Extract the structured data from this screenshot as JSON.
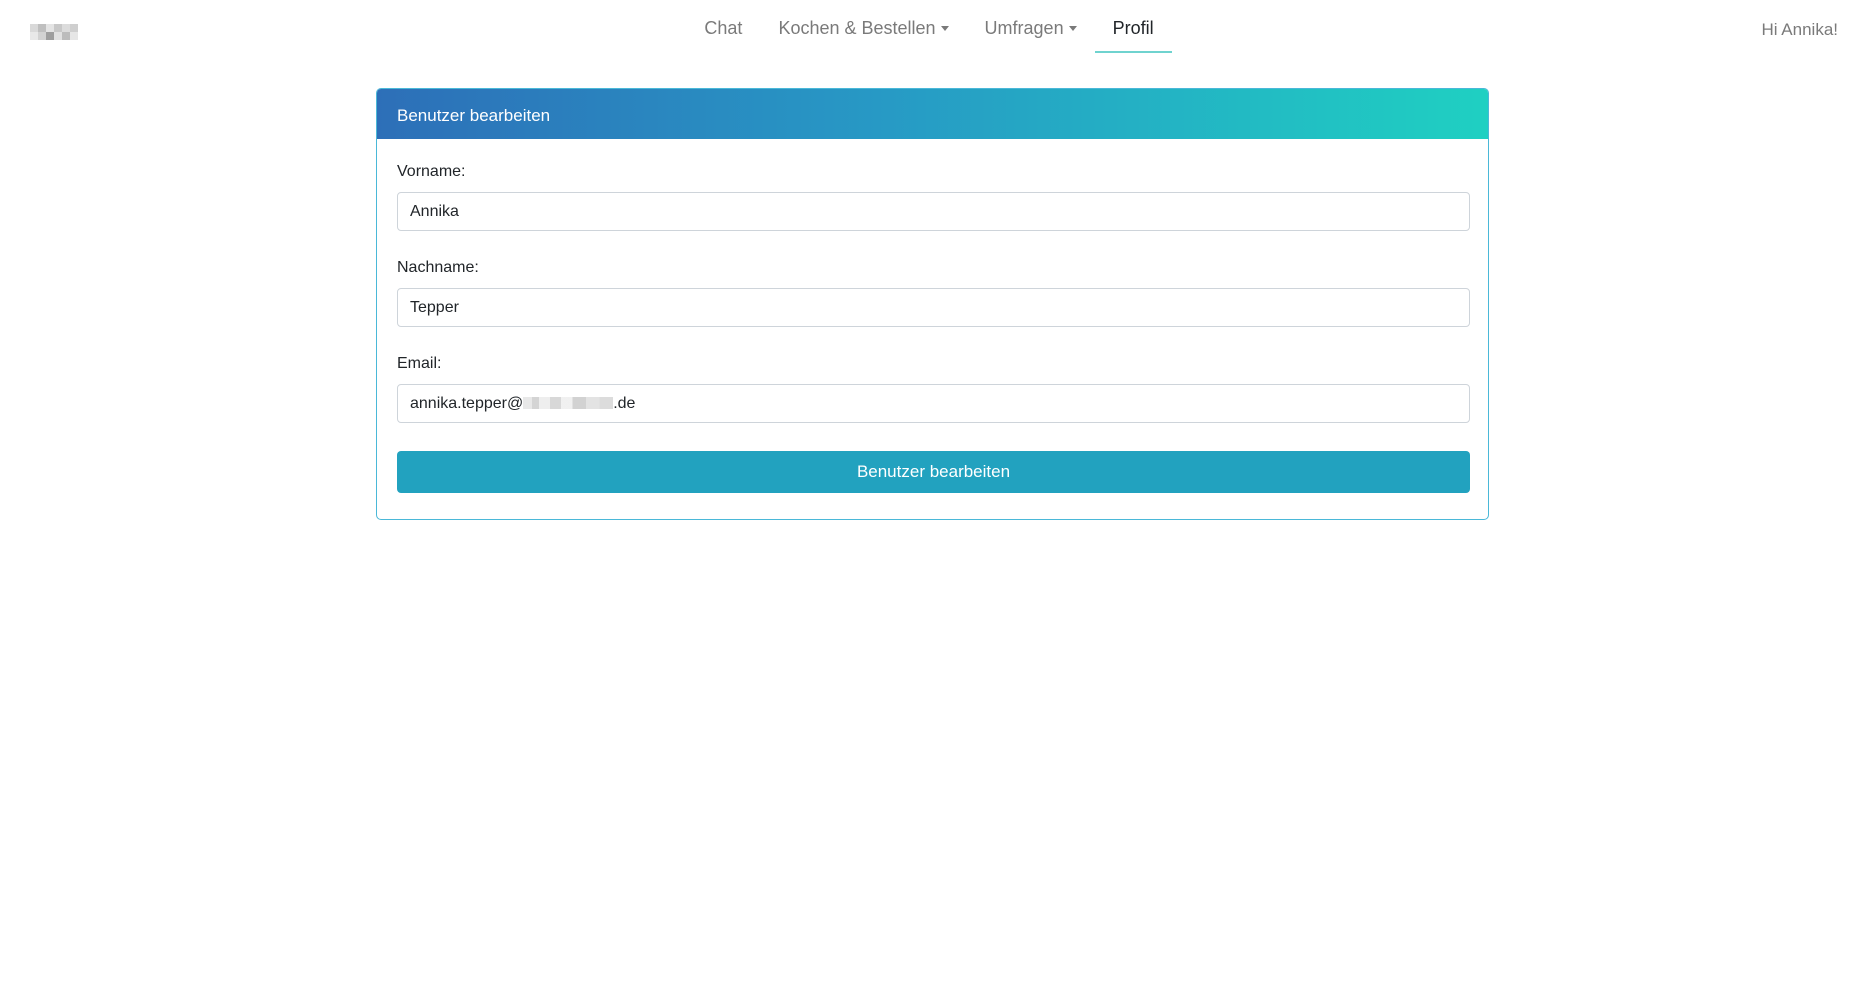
{
  "nav": {
    "items": [
      {
        "label": "Chat",
        "dropdown": false,
        "active": false
      },
      {
        "label": "Kochen & Bestellen",
        "dropdown": true,
        "active": false
      },
      {
        "label": "Umfragen",
        "dropdown": true,
        "active": false
      },
      {
        "label": "Profil",
        "dropdown": false,
        "active": true
      }
    ],
    "greeting": "Hi Annika!"
  },
  "card": {
    "title": "Benutzer bearbeiten",
    "fields": {
      "firstname": {
        "label": "Vorname:",
        "value": "Annika"
      },
      "lastname": {
        "label": "Nachname:",
        "value": "Tepper"
      },
      "email": {
        "label": "Email:",
        "value_prefix": "annika.tepper@",
        "value_suffix": ".de"
      }
    },
    "submit_label": "Benutzer bearbeiten"
  },
  "colors": {
    "header_gradient_start": "#2d6fb8",
    "header_gradient_end": "#1fd0c2",
    "button": "#22a2bf",
    "active_underline": "#6fd3cf",
    "card_border": "#4ab8d8"
  }
}
